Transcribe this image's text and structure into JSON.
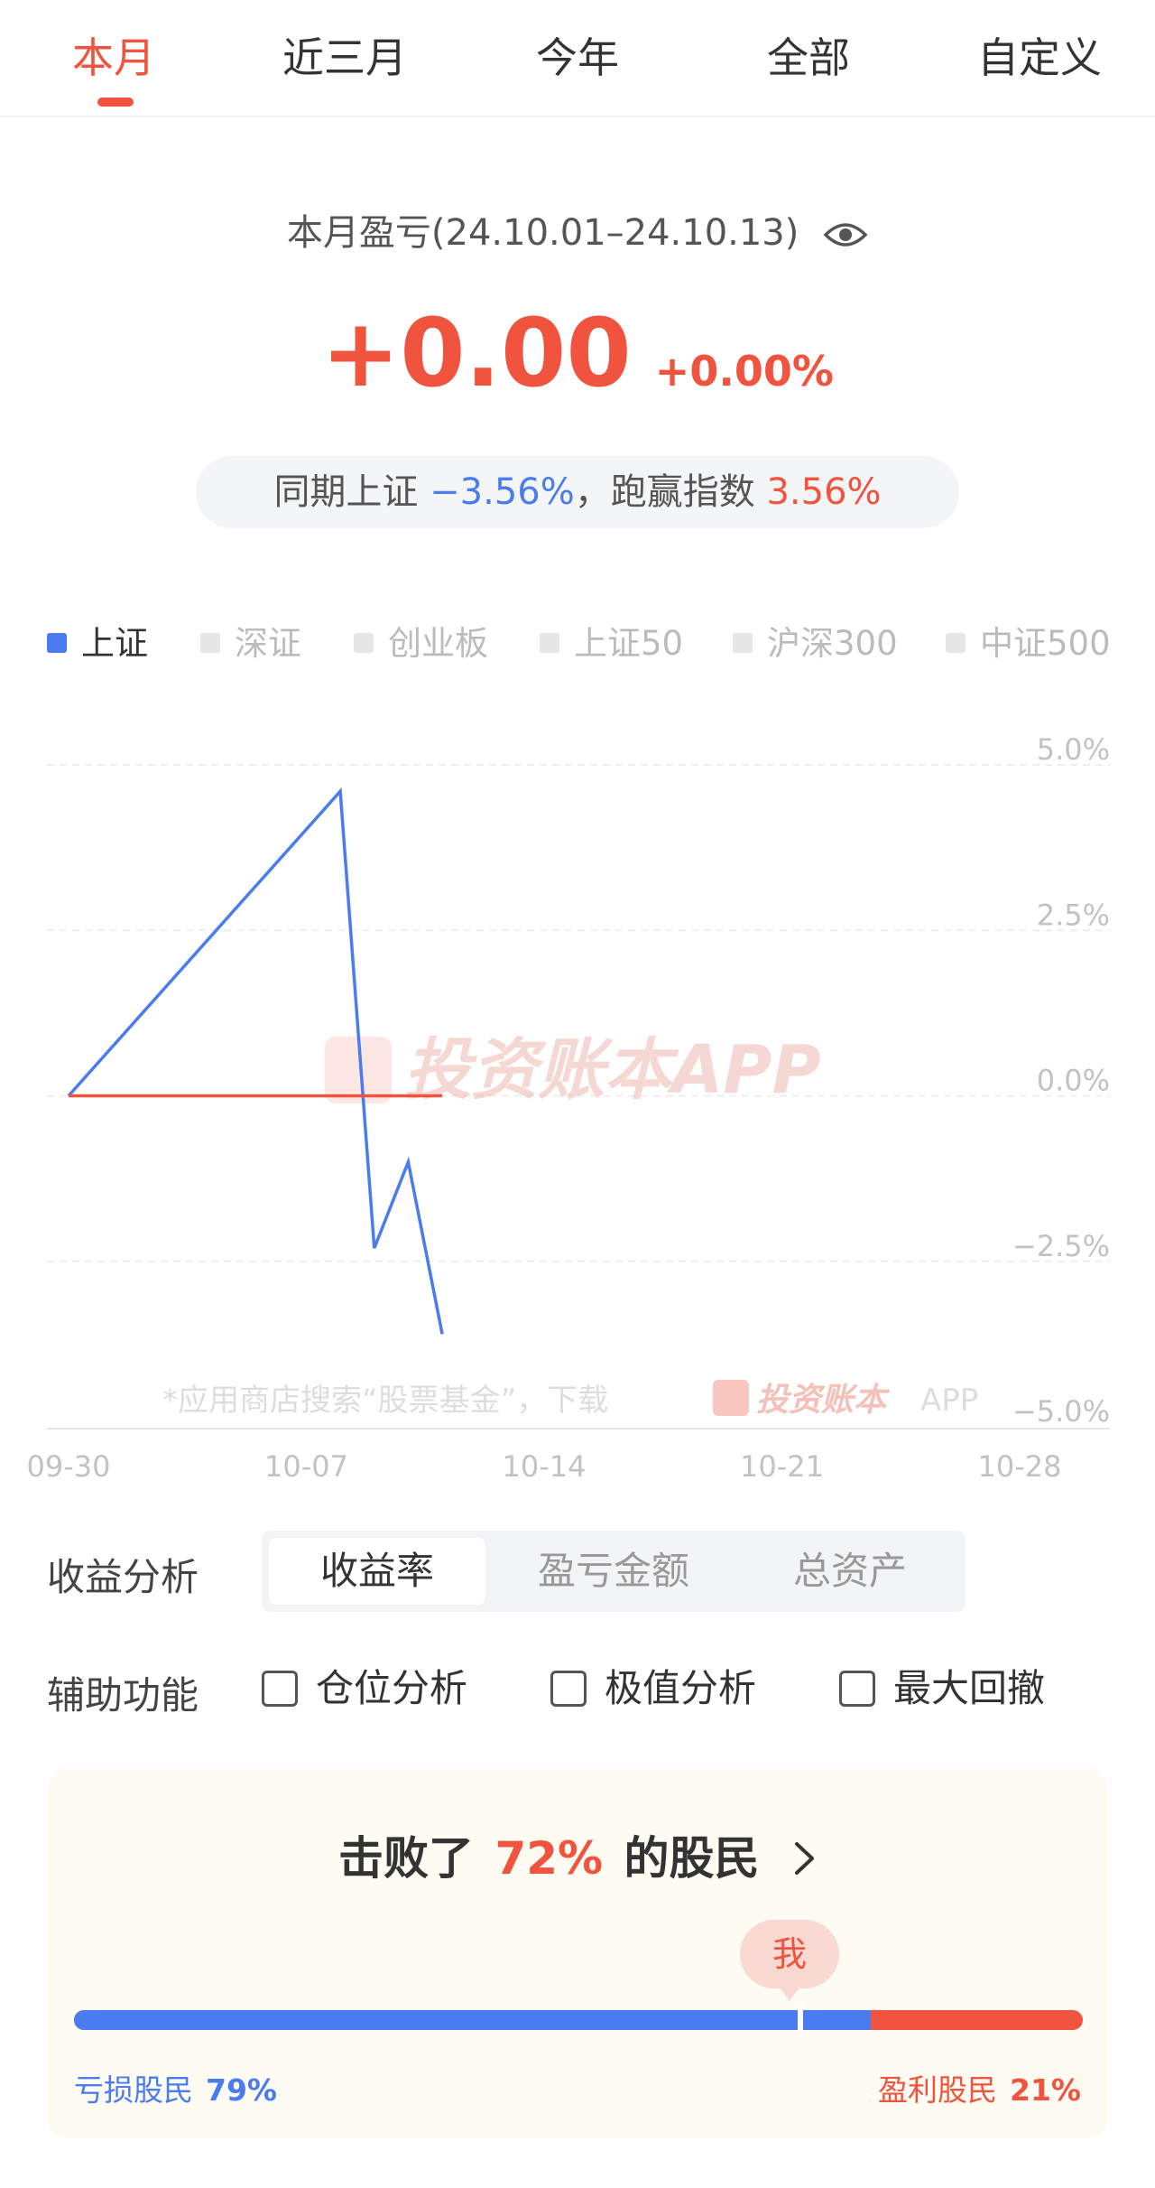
{
  "tabs": [
    "本月",
    "近三月",
    "今年",
    "全部",
    "自定义"
  ],
  "active_tab": 0,
  "summary": {
    "period_label": "本月盈亏(24.10.01–24.10.13)",
    "eye_icon": "eye-icon",
    "pnl_amount": "+0.00",
    "pnl_percent": "+0.00%",
    "bench_prefix": "同期上证",
    "bench_value": "−3.56%",
    "bench_sep": "，",
    "beat_label": "跑赢指数",
    "beat_value": "3.56%"
  },
  "indices": [
    {
      "label": "上证",
      "active": true
    },
    {
      "label": "深证",
      "active": false
    },
    {
      "label": "创业板",
      "active": false
    },
    {
      "label": "上证50",
      "active": false
    },
    {
      "label": "沪深300",
      "active": false
    },
    {
      "label": "中证500",
      "active": false
    }
  ],
  "chart_data": {
    "type": "line",
    "title": "",
    "xlabel": "",
    "ylabel": "",
    "x_ticks": [
      "09-30",
      "10-07",
      "10-14",
      "10-21",
      "10-28"
    ],
    "y_ticks": [
      "5.0%",
      "2.5%",
      "0.0%",
      "−2.5%",
      "−5.0%"
    ],
    "ylim": [
      -5.0,
      5.0
    ],
    "grid": true,
    "series": [
      {
        "name": "上证",
        "color": "#4a7cf0",
        "dates": [
          "09-30",
          "10-08",
          "10-09",
          "10-10",
          "10-11"
        ],
        "values": [
          0.0,
          4.6,
          -2.3,
          -1.0,
          -3.6
        ]
      },
      {
        "color": "#f0533e",
        "dates": [
          "09-30",
          "10-11"
        ],
        "values": [
          0.0,
          0.0
        ]
      }
    ],
    "watermark": "投资账本APP",
    "footer_note": "*应用商店搜索“股票基金”，下载",
    "footer_brand": "投资账本",
    "footer_app": "APP"
  },
  "analysis": {
    "label": "收益分析",
    "options": [
      "收益率",
      "盈亏金额",
      "总资产"
    ],
    "active": 0
  },
  "auxiliary": {
    "label": "辅助功能",
    "options": [
      {
        "label": "仓位分析",
        "checked": false
      },
      {
        "label": "极值分析",
        "checked": false
      },
      {
        "label": "最大回撤",
        "checked": false
      }
    ]
  },
  "beat": {
    "prefix": "击败了",
    "percent": "72%",
    "suffix": "的股民",
    "me_label": "我",
    "loss_label": "亏损股民",
    "loss_percent": "79%",
    "profit_label": "盈利股民",
    "profit_percent": "21%",
    "loss_fraction": 0.79,
    "rank_fraction": 0.72,
    "colors": {
      "loss": "#4a7cf0",
      "profit": "#f0533e"
    }
  }
}
